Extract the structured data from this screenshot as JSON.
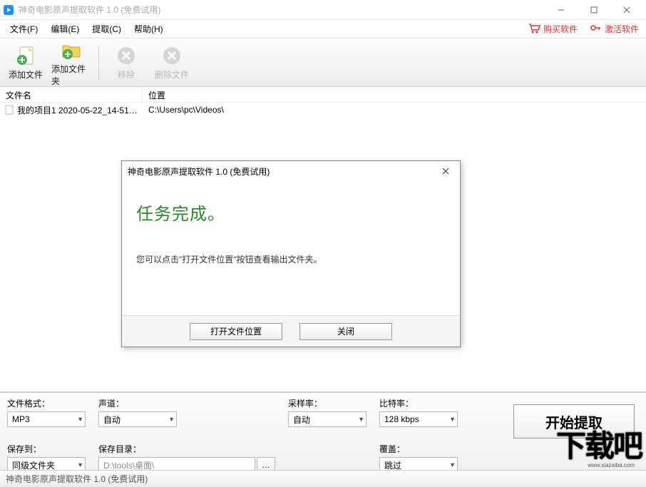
{
  "app": {
    "title": "神奇电影原声提取软件 1.0 (免费试用)"
  },
  "menu": {
    "file": "文件(F)",
    "edit": "编辑(E)",
    "extract": "提取(C)",
    "help": "帮助(H)",
    "buy": "购买软件",
    "activate": "激活软件"
  },
  "toolbar": {
    "add_file": "添加文件",
    "add_folder": "添加文件夹",
    "remove": "移除",
    "delete_file": "删除文件"
  },
  "list": {
    "col_filename": "文件名",
    "col_location": "位置",
    "rows": [
      {
        "filename": "我的项目1 2020-05-22_14-51…",
        "location": "C:\\Users\\pc\\Videos\\"
      }
    ]
  },
  "settings": {
    "format_label": "文件格式：",
    "format_value": "MP3",
    "channel_label": "声道：",
    "channel_value": "自动",
    "samplerate_label": "采样率：",
    "samplerate_value": "自动",
    "bitrate_label": "比特率：",
    "bitrate_value": "128 kbps",
    "saveto_label": "保存到：",
    "saveto_value": "同级文件夹",
    "savedir_label": "保存目录：",
    "savedir_value": "D:\\tools\\桌面\\",
    "overwrite_label": "覆盖：",
    "overwrite_value": "跳过",
    "start_button": "开始提取",
    "browse": "…"
  },
  "status": {
    "text": "神奇电影原声提取软件 1.0 (免费试用)"
  },
  "dialog": {
    "title": "神奇电影原声提取软件 1.0 (免费试用)",
    "heading": "任务完成。",
    "message": "您可以点击\"打开文件位置\"按钮查看输出文件夹。",
    "open_location": "打开文件位置",
    "close": "关闭"
  },
  "watermark": {
    "main": "下载吧",
    "sub": "www.xiazaiba.com"
  }
}
